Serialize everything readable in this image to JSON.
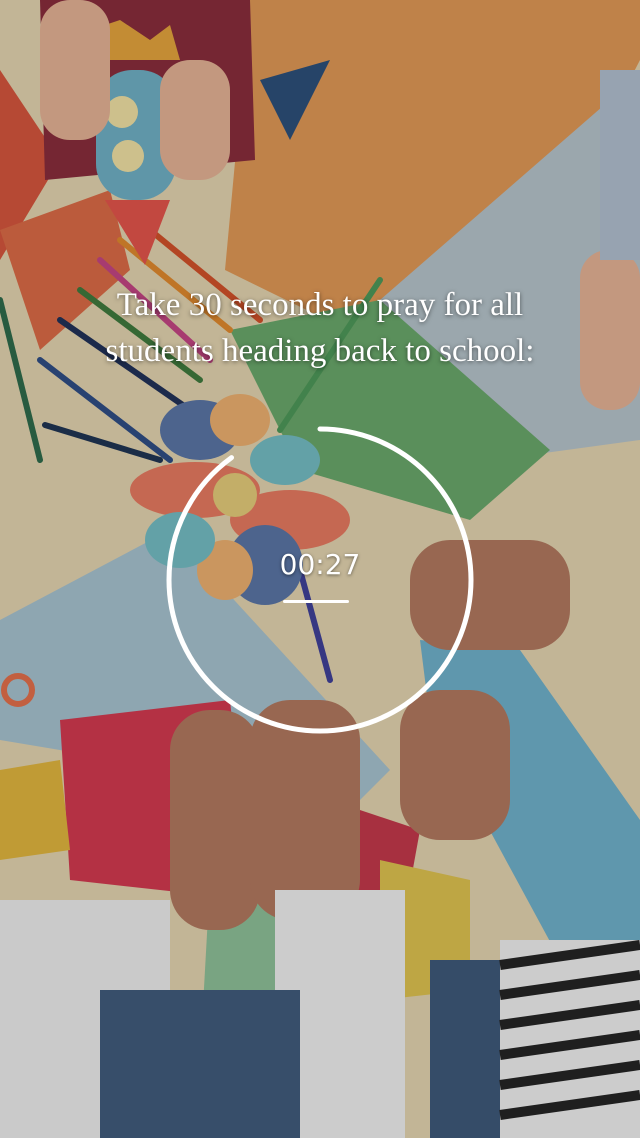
{
  "prompt": {
    "line1": "Take 30 seconds to pray for all",
    "line2": "students heading back to school:"
  },
  "timer": {
    "time": "00:27",
    "progress_fraction": 0.9
  },
  "colors": {
    "ring": "#ffffff",
    "text": "#ffffff"
  }
}
